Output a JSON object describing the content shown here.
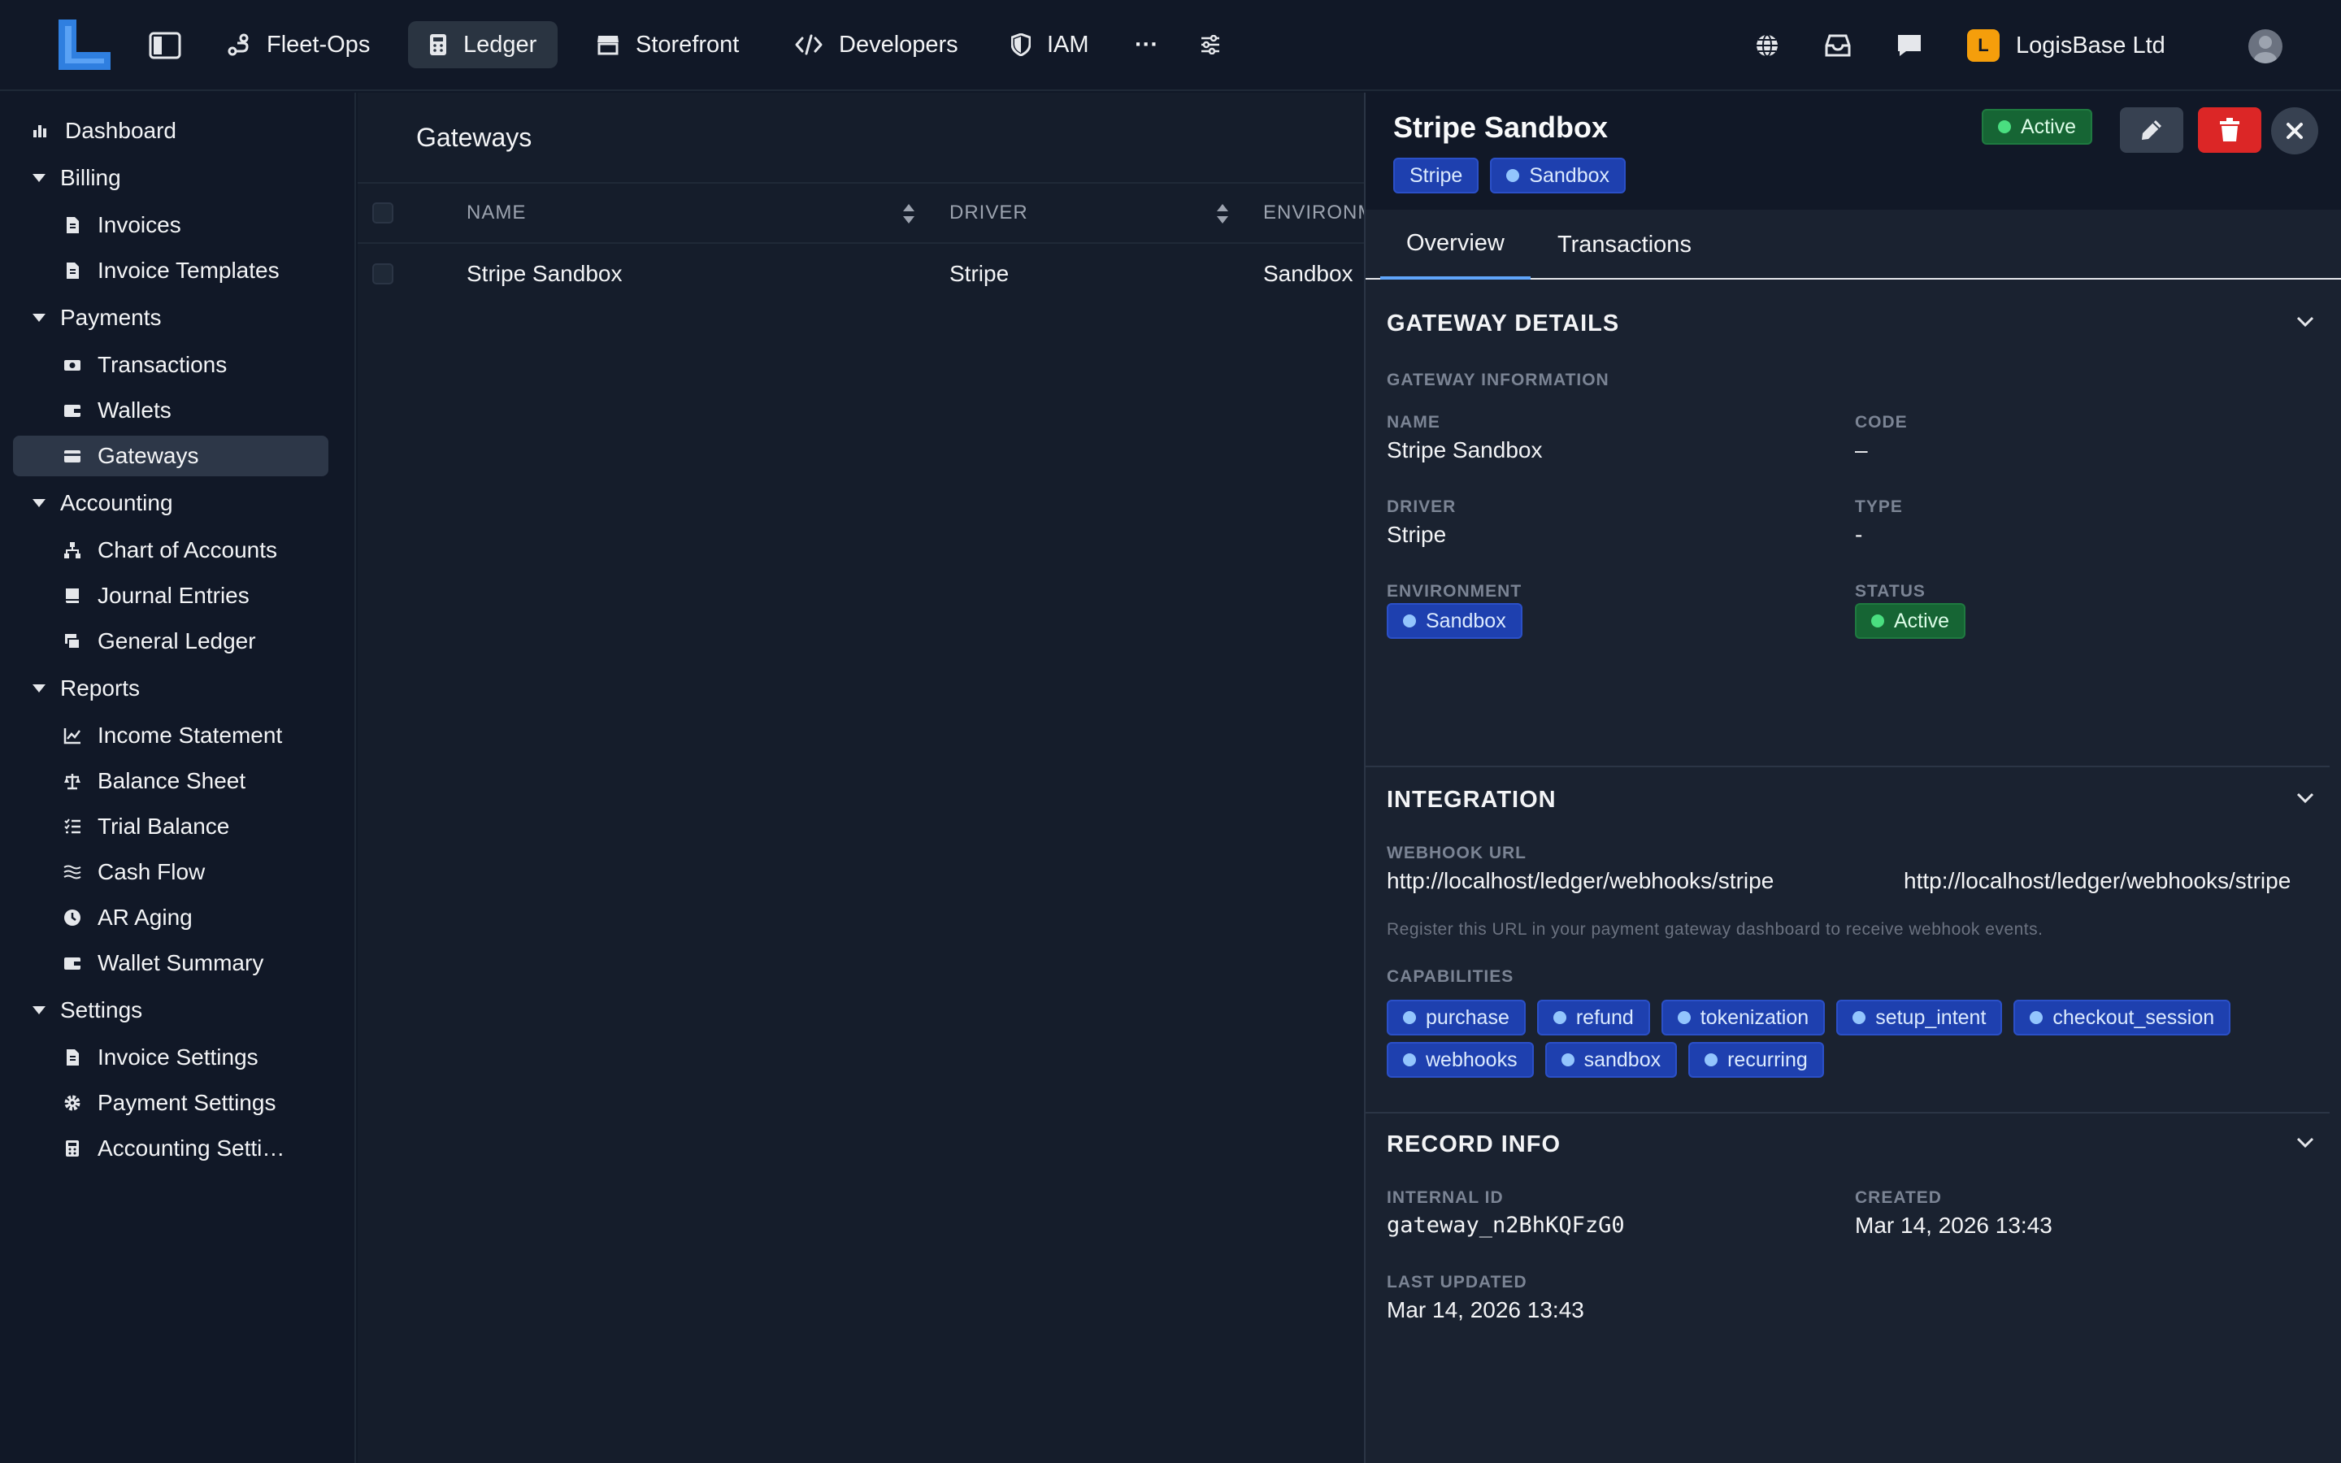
{
  "topnav": {
    "items": [
      {
        "label": "Fleet-Ops",
        "icon": "route-icon"
      },
      {
        "label": "Ledger",
        "icon": "calculator-icon",
        "active": true
      },
      {
        "label": "Storefront",
        "icon": "store-icon"
      },
      {
        "label": "Developers",
        "icon": "code-icon"
      },
      {
        "label": "IAM",
        "icon": "shield-icon"
      }
    ],
    "more_label": "···",
    "org_badge": "L",
    "org_name": "LogisBase Ltd"
  },
  "sidebar": {
    "dashboard": "Dashboard",
    "billing": "Billing",
    "invoices": "Invoices",
    "invoice_templates": "Invoice Templates",
    "payments": "Payments",
    "transactions": "Transactions",
    "wallets": "Wallets",
    "gateways": "Gateways",
    "accounting": "Accounting",
    "chart_of_accounts": "Chart of Accounts",
    "journal_entries": "Journal Entries",
    "general_ledger": "General Ledger",
    "reports": "Reports",
    "income_statement": "Income Statement",
    "balance_sheet": "Balance Sheet",
    "trial_balance": "Trial Balance",
    "cash_flow": "Cash Flow",
    "ar_aging": "AR Aging",
    "wallet_summary": "Wallet Summary",
    "settings": "Settings",
    "invoice_settings": "Invoice Settings",
    "payment_settings": "Payment Settings",
    "accounting_settings": "Accounting Setti…"
  },
  "main": {
    "title": "Gateways",
    "columns": {
      "name": "NAME",
      "driver": "DRIVER",
      "environment": "ENVIRONM"
    },
    "rows": [
      {
        "name": "Stripe Sandbox",
        "driver": "Stripe",
        "environment": "Sandbox"
      }
    ]
  },
  "panel": {
    "title": "Stripe Sandbox",
    "tag_driver": "Stripe",
    "tag_env": "Sandbox",
    "status": "Active",
    "tabs": {
      "overview": "Overview",
      "transactions": "Transactions"
    },
    "gateway_details": {
      "title": "GATEWAY DETAILS",
      "subheading": "GATEWAY INFORMATION",
      "name_label": "NAME",
      "name_value": "Stripe Sandbox",
      "code_label": "CODE",
      "code_value": "–",
      "driver_label": "DRIVER",
      "driver_value": "Stripe",
      "type_label": "TYPE",
      "type_value": "-",
      "environment_label": "ENVIRONMENT",
      "environment_value": "Sandbox",
      "status_label": "STATUS",
      "status_value": "Active"
    },
    "integration": {
      "title": "INTEGRATION",
      "webhook_label": "WEBHOOK URL",
      "webhook_value": "http://localhost/ledger/webhooks/stripe",
      "webhook_copy": "http://localhost/ledger/webhooks/stripe",
      "webhook_help": "Register this URL in your payment gateway dashboard to receive webhook events.",
      "capabilities_label": "CAPABILITIES",
      "capabilities_row1": [
        "purchase",
        "refund",
        "tokenization",
        "setup_intent",
        "checkout_session"
      ],
      "capabilities_row2": [
        "webhooks",
        "sandbox",
        "recurring"
      ]
    },
    "record_info": {
      "title": "RECORD INFO",
      "internal_id_label": "INTERNAL ID",
      "internal_id_value": "gateway_n2BhKQFzG0",
      "created_label": "CREATED",
      "created_value": "Mar 14, 2026 13:43",
      "updated_label": "LAST UPDATED",
      "updated_value": "Mar 14, 2026 13:43"
    }
  },
  "colors": {
    "background": "#111827",
    "panel": "#1a2230",
    "accent_blue": "#1e40af",
    "success_green": "#166534",
    "danger_red": "#dc2626",
    "org_badge": "#f59e0b"
  }
}
